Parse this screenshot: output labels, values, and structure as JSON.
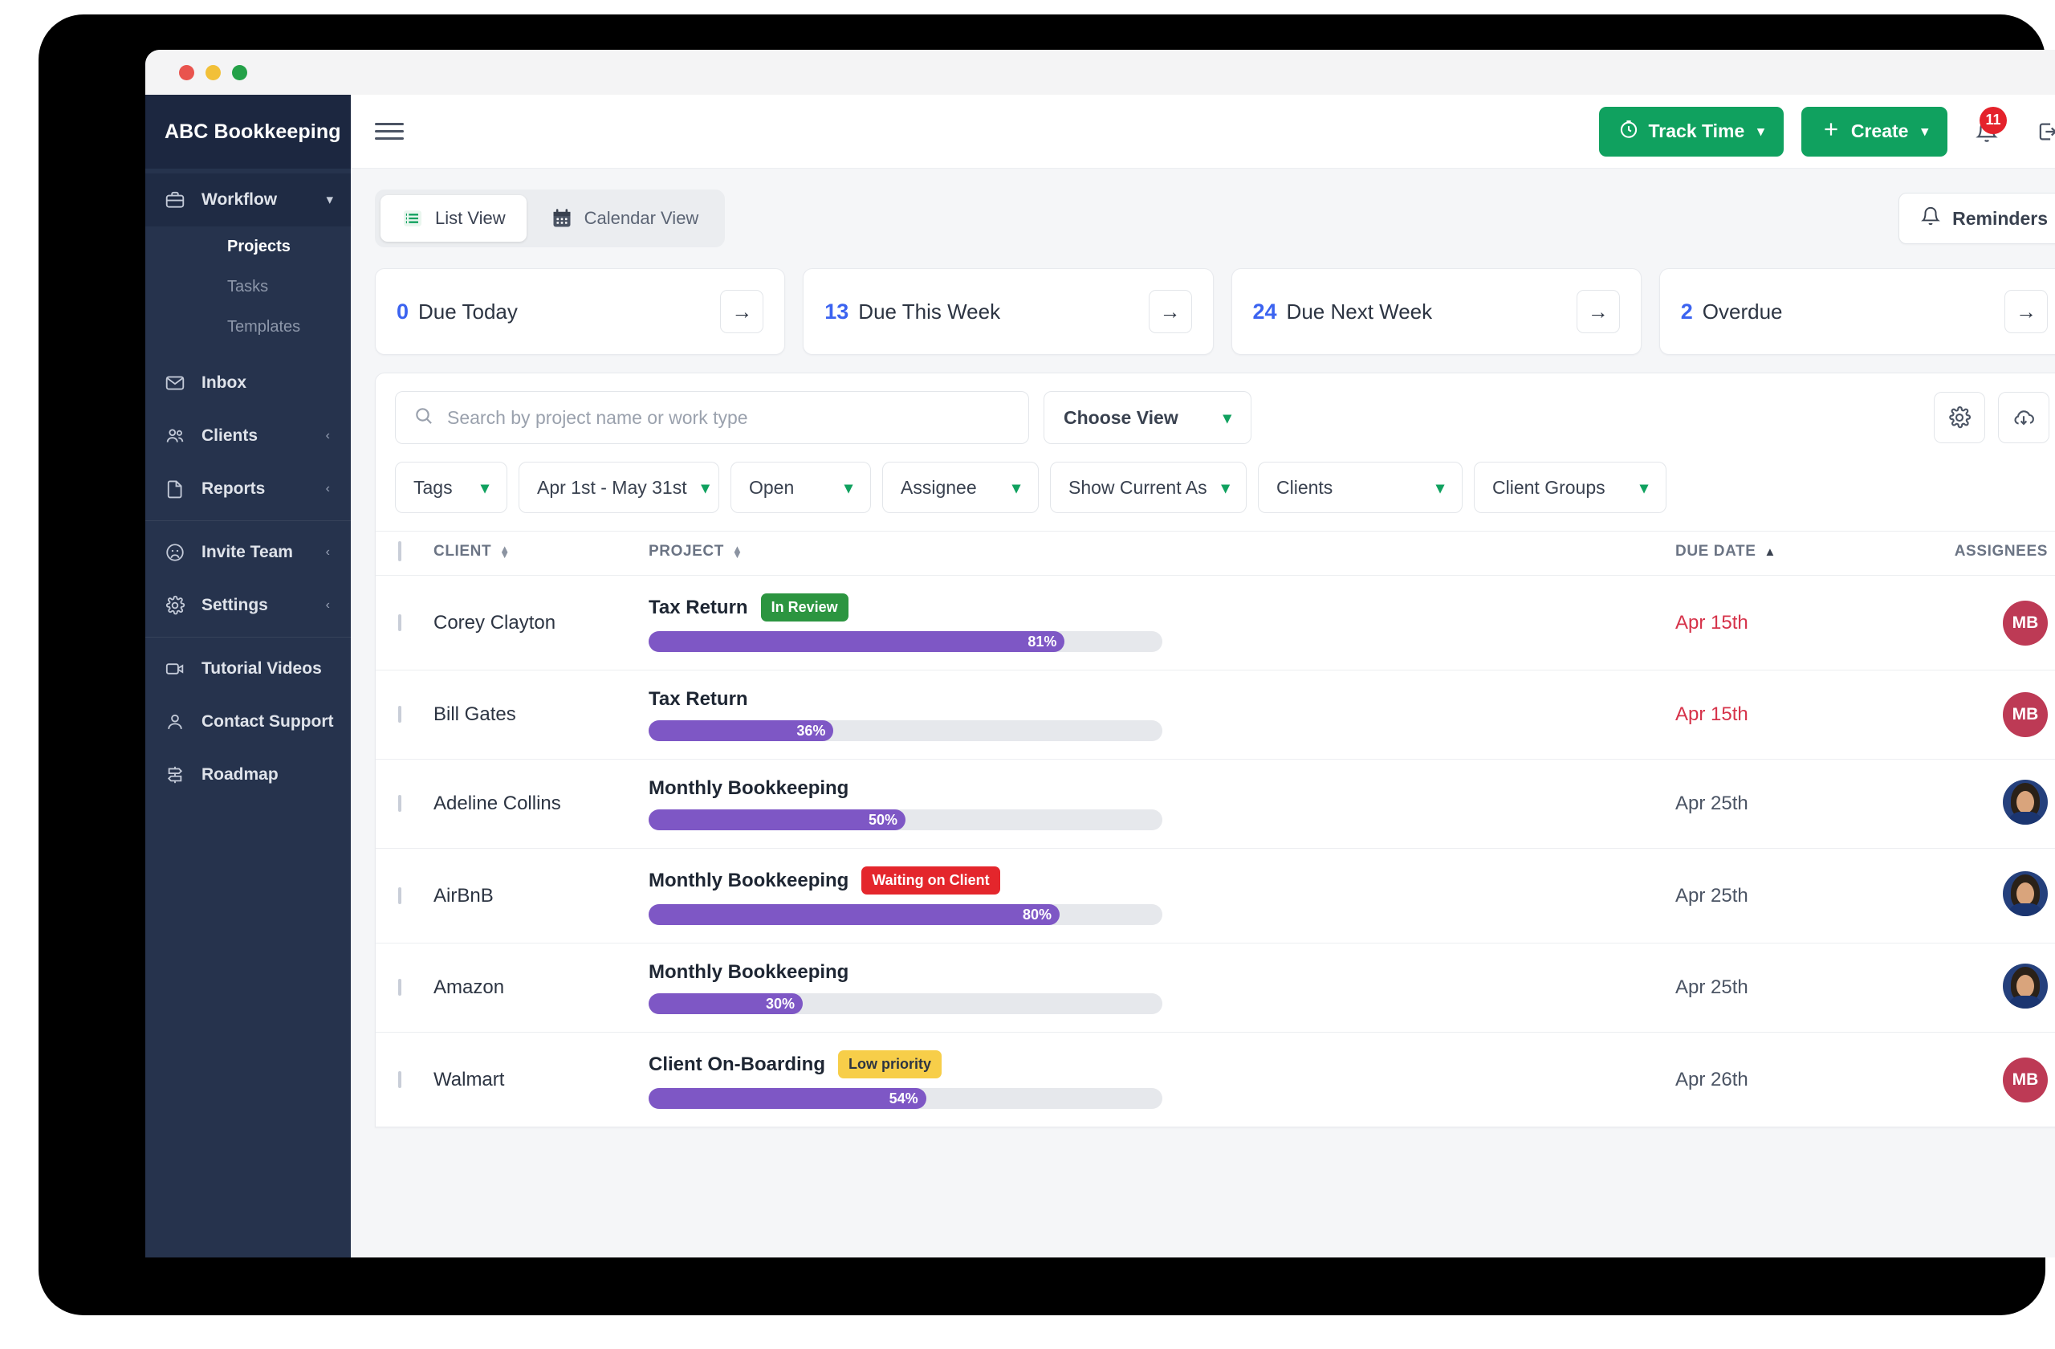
{
  "window": {
    "dots": [
      "close",
      "minimize",
      "maximize"
    ]
  },
  "sidebar": {
    "brand": "ABC Bookkeeping",
    "workflow": {
      "label": "Workflow",
      "children": [
        {
          "label": "Projects",
          "current": true
        },
        {
          "label": "Tasks",
          "current": false
        },
        {
          "label": "Templates",
          "current": false
        }
      ]
    },
    "group_main": [
      {
        "label": "Inbox",
        "icon": "mail-icon",
        "chevron": ""
      },
      {
        "label": "Clients",
        "icon": "users-icon",
        "chevron": "‹"
      },
      {
        "label": "Reports",
        "icon": "file-icon",
        "chevron": "‹"
      }
    ],
    "group_admin": [
      {
        "label": "Invite Team",
        "icon": "team-icon",
        "chevron": "‹"
      },
      {
        "label": "Settings",
        "icon": "gear-icon",
        "chevron": "‹"
      }
    ],
    "group_help": [
      {
        "label": "Tutorial Videos",
        "icon": "video-icon",
        "chevron": ""
      },
      {
        "label": "Contact Support",
        "icon": "person-icon",
        "chevron": ""
      },
      {
        "label": "Roadmap",
        "icon": "roadmap-icon",
        "chevron": ""
      }
    ]
  },
  "topbar": {
    "track_time": "Track Time",
    "create": "Create",
    "caret": "⌄",
    "notification_count": "11"
  },
  "views": {
    "list_view": "List View",
    "calendar_view": "Calendar View",
    "reminders": "Reminders"
  },
  "stats": [
    {
      "count": "0",
      "label": "Due Today"
    },
    {
      "count": "13",
      "label": "Due This Week"
    },
    {
      "count": "24",
      "label": "Due Next Week"
    },
    {
      "count": "2",
      "label": "Overdue"
    }
  ],
  "search": {
    "placeholder": "Search by project name or work type",
    "value": ""
  },
  "choose_view": {
    "label": "Choose View",
    "caret": "⌄"
  },
  "filters": [
    {
      "label": "Tags",
      "caret": "⌄"
    },
    {
      "label": "Apr 1st - May 31st",
      "caret": "⌄"
    },
    {
      "label": "Open",
      "caret": "⌄"
    },
    {
      "label": "Assignee",
      "caret": "⌄"
    },
    {
      "label": "Show Current As",
      "caret": "⌄"
    },
    {
      "label": "Clients",
      "caret": "⌄"
    },
    {
      "label": "Client Groups",
      "caret": "⌄"
    }
  ],
  "table": {
    "headers": {
      "client": "CLIENT",
      "project": "PROJECT",
      "due_date": "DUE DATE",
      "assignees": "ASSIGNEES"
    },
    "sort": {
      "column": "DUE DATE",
      "direction": "asc"
    },
    "rows": [
      {
        "client": "Corey Clayton",
        "project": "Tax Return",
        "tag": "In Review",
        "tag_color": "green",
        "progress": 81,
        "progress_label": "81%",
        "due_date": "Apr 15th",
        "overdue": true,
        "assignee_type": "initials",
        "assignee_initials": "MB"
      },
      {
        "client": "Bill Gates",
        "project": "Tax Return",
        "tag": "",
        "tag_color": "",
        "progress": 36,
        "progress_label": "36%",
        "due_date": "Apr 15th",
        "overdue": true,
        "assignee_type": "initials",
        "assignee_initials": "MB"
      },
      {
        "client": "Adeline Collins",
        "project": "Monthly Bookkeeping",
        "tag": "",
        "tag_color": "",
        "progress": 50,
        "progress_label": "50%",
        "due_date": "Apr 25th",
        "overdue": false,
        "assignee_type": "photo",
        "assignee_initials": ""
      },
      {
        "client": "AirBnB",
        "project": "Monthly Bookkeeping",
        "tag": "Waiting on Client",
        "tag_color": "red",
        "progress": 80,
        "progress_label": "80%",
        "due_date": "Apr 25th",
        "overdue": false,
        "assignee_type": "photo",
        "assignee_initials": ""
      },
      {
        "client": "Amazon",
        "project": "Monthly Bookkeeping",
        "tag": "",
        "tag_color": "",
        "progress": 30,
        "progress_label": "30%",
        "due_date": "Apr 25th",
        "overdue": false,
        "assignee_type": "photo",
        "assignee_initials": ""
      },
      {
        "client": "Walmart",
        "project": "Client On-Boarding",
        "tag": "Low priority",
        "tag_color": "yellow",
        "progress": 54,
        "progress_label": "54%",
        "due_date": "Apr 26th",
        "overdue": false,
        "assignee_type": "initials",
        "assignee_initials": "MB"
      }
    ]
  },
  "colors": {
    "sidebar": "#26334d",
    "accent_green": "#10a15f",
    "progress_purple": "#7e57c5",
    "overdue_red": "#d6334a",
    "stat_number_blue": "#3b63f0",
    "badge_red": "#e4222b"
  }
}
